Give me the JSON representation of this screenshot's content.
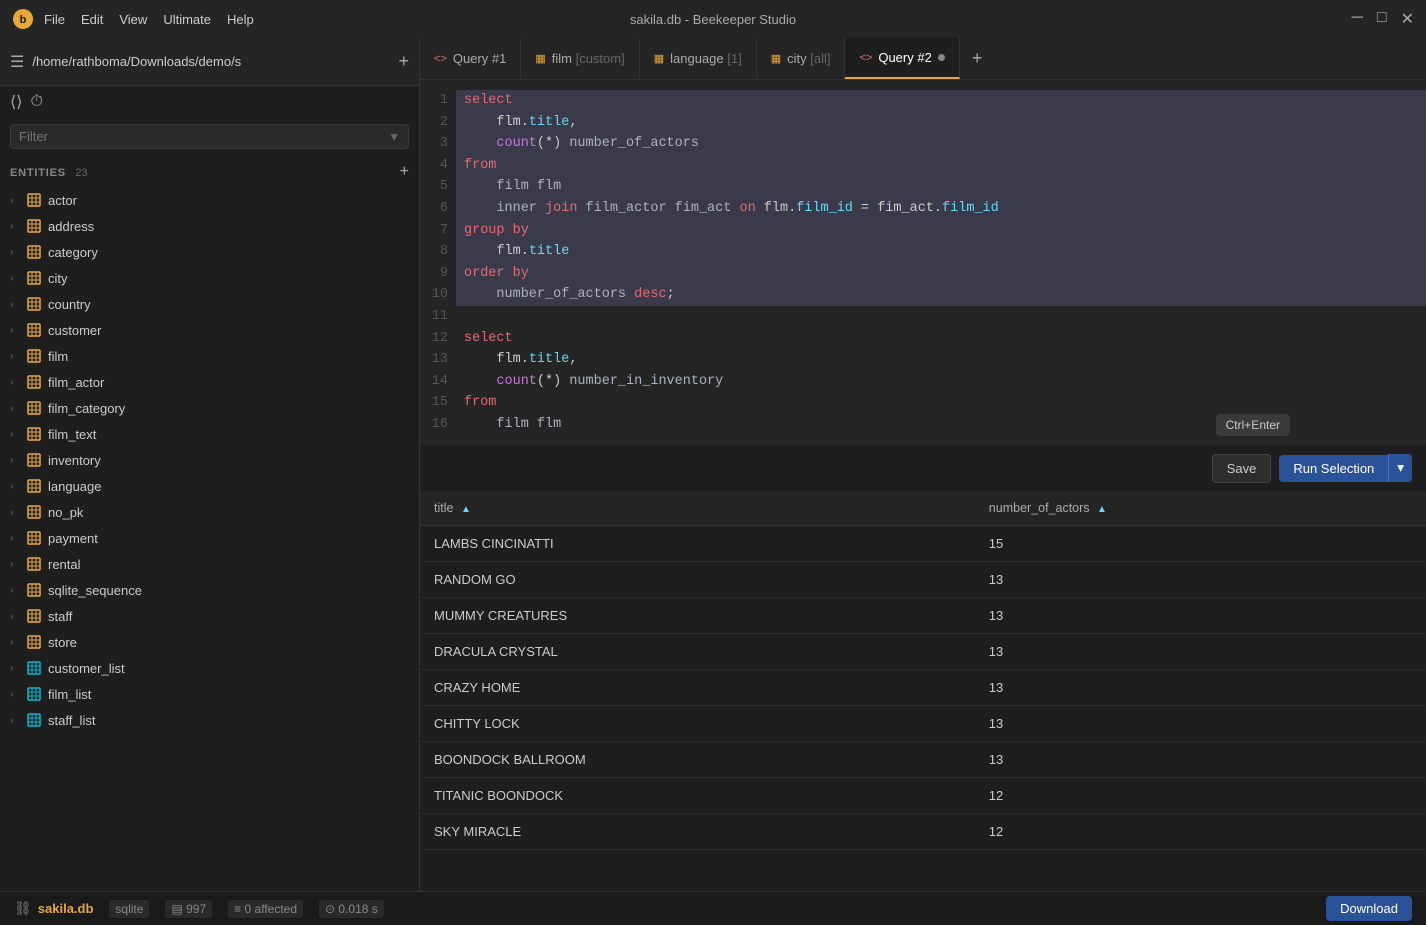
{
  "titlebar": {
    "title": "sakila.db - Beekeeper Studio",
    "menu_items": [
      "File",
      "Edit",
      "View",
      "Ultimate",
      "Help"
    ],
    "controls": [
      "─",
      "□",
      "✕"
    ]
  },
  "sidebar": {
    "path": "/home/rathboma/Downloads/demo/s",
    "filter_placeholder": "Filter",
    "entities_label": "ENTITIES",
    "entities_count": "23",
    "entities": [
      {
        "name": "actor",
        "type": "table"
      },
      {
        "name": "address",
        "type": "table"
      },
      {
        "name": "category",
        "type": "table"
      },
      {
        "name": "city",
        "type": "table"
      },
      {
        "name": "country",
        "type": "table"
      },
      {
        "name": "customer",
        "type": "table"
      },
      {
        "name": "film",
        "type": "table"
      },
      {
        "name": "film_actor",
        "type": "table"
      },
      {
        "name": "film_category",
        "type": "table"
      },
      {
        "name": "film_text",
        "type": "table"
      },
      {
        "name": "inventory",
        "type": "table"
      },
      {
        "name": "language",
        "type": "table"
      },
      {
        "name": "no_pk",
        "type": "table"
      },
      {
        "name": "payment",
        "type": "table"
      },
      {
        "name": "rental",
        "type": "table"
      },
      {
        "name": "sqlite_sequence",
        "type": "table"
      },
      {
        "name": "staff",
        "type": "table"
      },
      {
        "name": "store",
        "type": "table"
      },
      {
        "name": "customer_list",
        "type": "view"
      },
      {
        "name": "film_list",
        "type": "view"
      },
      {
        "name": "staff_list",
        "type": "view"
      }
    ]
  },
  "tabs": [
    {
      "id": "query1",
      "label": "Query #1",
      "icon": "<>",
      "active": false
    },
    {
      "id": "film",
      "label": "film [custom]",
      "icon": "▦",
      "active": false
    },
    {
      "id": "language",
      "label": "language [1]",
      "icon": "▦",
      "active": false
    },
    {
      "id": "city",
      "label": "city [all]",
      "icon": "▦",
      "active": false
    },
    {
      "id": "query2",
      "label": "Query #2",
      "icon": "<>",
      "active": true,
      "dot": true
    }
  ],
  "editor": {
    "lines": [
      {
        "num": 1,
        "code": "select",
        "selected": true
      },
      {
        "num": 2,
        "code": "    flm.title,",
        "selected": true
      },
      {
        "num": 3,
        "code": "    count(*) number_of_actors",
        "selected": true
      },
      {
        "num": 4,
        "code": "from",
        "selected": true
      },
      {
        "num": 5,
        "code": "    film flm",
        "selected": true
      },
      {
        "num": 6,
        "code": "    inner join film_actor fim_act on flm.film_id = fim_act.film_id",
        "selected": true
      },
      {
        "num": 7,
        "code": "group by",
        "selected": true
      },
      {
        "num": 8,
        "code": "    flm.title",
        "selected": true
      },
      {
        "num": 9,
        "code": "order by",
        "selected": true
      },
      {
        "num": 10,
        "code": "    number_of_actors desc;",
        "selected": true
      },
      {
        "num": 11,
        "code": "",
        "selected": false
      },
      {
        "num": 12,
        "code": "select",
        "selected": false
      },
      {
        "num": 13,
        "code": "    flm.title,",
        "selected": false
      },
      {
        "num": 14,
        "code": "    count(*) number_in_inventory",
        "selected": false
      },
      {
        "num": 15,
        "code": "from",
        "selected": false
      },
      {
        "num": 16,
        "code": "    film flm",
        "selected": false
      }
    ]
  },
  "toolbar": {
    "tooltip": "Ctrl+Enter",
    "save_label": "Save",
    "run_label": "Run Selection",
    "run_caret": "▾"
  },
  "results": {
    "columns": [
      {
        "key": "title",
        "label": "title",
        "sorted": true
      },
      {
        "key": "number_of_actors",
        "label": "number_of_actors",
        "sorted": true
      }
    ],
    "rows": [
      {
        "title": "LAMBS CINCINATTI",
        "number_of_actors": "15"
      },
      {
        "title": "RANDOM GO",
        "number_of_actors": "13"
      },
      {
        "title": "MUMMY CREATURES",
        "number_of_actors": "13"
      },
      {
        "title": "DRACULA CRYSTAL",
        "number_of_actors": "13"
      },
      {
        "title": "CRAZY HOME",
        "number_of_actors": "13"
      },
      {
        "title": "CHITTY LOCK",
        "number_of_actors": "13"
      },
      {
        "title": "BOONDOCK BALLROOM",
        "number_of_actors": "13"
      },
      {
        "title": "TITANIC BOONDOCK",
        "number_of_actors": "12"
      },
      {
        "title": "SKY MIRACLE",
        "number_of_actors": "12"
      }
    ]
  },
  "statusbar": {
    "db_name": "sakila.db",
    "db_type": "sqlite",
    "rows_count": "997",
    "affected": "0 affected",
    "time": "0.018 s",
    "download_label": "Download"
  }
}
